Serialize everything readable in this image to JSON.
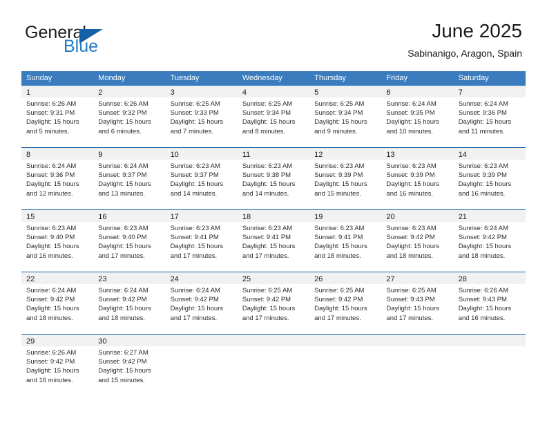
{
  "brand": {
    "name_part1": "General",
    "name_part2": "Blue",
    "mark": "triangle-logo"
  },
  "header": {
    "title": "June 2025",
    "subtitle": "Sabinanigo, Aragon, Spain"
  },
  "calendar": {
    "weekdays": [
      "Sunday",
      "Monday",
      "Tuesday",
      "Wednesday",
      "Thursday",
      "Friday",
      "Saturday"
    ],
    "accent_color": "#3a7cbe",
    "rule_color": "#1461a8",
    "daynum_band_color": "#f1f1f1",
    "weeks": [
      {
        "days": [
          {
            "num": "1",
            "sunrise": "Sunrise: 6:26 AM",
            "sunset": "Sunset: 9:31 PM",
            "daylight_line1": "Daylight: 15 hours",
            "daylight_line2": "and 5 minutes."
          },
          {
            "num": "2",
            "sunrise": "Sunrise: 6:26 AM",
            "sunset": "Sunset: 9:32 PM",
            "daylight_line1": "Daylight: 15 hours",
            "daylight_line2": "and 6 minutes."
          },
          {
            "num": "3",
            "sunrise": "Sunrise: 6:25 AM",
            "sunset": "Sunset: 9:33 PM",
            "daylight_line1": "Daylight: 15 hours",
            "daylight_line2": "and 7 minutes."
          },
          {
            "num": "4",
            "sunrise": "Sunrise: 6:25 AM",
            "sunset": "Sunset: 9:34 PM",
            "daylight_line1": "Daylight: 15 hours",
            "daylight_line2": "and 8 minutes."
          },
          {
            "num": "5",
            "sunrise": "Sunrise: 6:25 AM",
            "sunset": "Sunset: 9:34 PM",
            "daylight_line1": "Daylight: 15 hours",
            "daylight_line2": "and 9 minutes."
          },
          {
            "num": "6",
            "sunrise": "Sunrise: 6:24 AM",
            "sunset": "Sunset: 9:35 PM",
            "daylight_line1": "Daylight: 15 hours",
            "daylight_line2": "and 10 minutes."
          },
          {
            "num": "7",
            "sunrise": "Sunrise: 6:24 AM",
            "sunset": "Sunset: 9:36 PM",
            "daylight_line1": "Daylight: 15 hours",
            "daylight_line2": "and 11 minutes."
          }
        ]
      },
      {
        "days": [
          {
            "num": "8",
            "sunrise": "Sunrise: 6:24 AM",
            "sunset": "Sunset: 9:36 PM",
            "daylight_line1": "Daylight: 15 hours",
            "daylight_line2": "and 12 minutes."
          },
          {
            "num": "9",
            "sunrise": "Sunrise: 6:24 AM",
            "sunset": "Sunset: 9:37 PM",
            "daylight_line1": "Daylight: 15 hours",
            "daylight_line2": "and 13 minutes."
          },
          {
            "num": "10",
            "sunrise": "Sunrise: 6:23 AM",
            "sunset": "Sunset: 9:37 PM",
            "daylight_line1": "Daylight: 15 hours",
            "daylight_line2": "and 14 minutes."
          },
          {
            "num": "11",
            "sunrise": "Sunrise: 6:23 AM",
            "sunset": "Sunset: 9:38 PM",
            "daylight_line1": "Daylight: 15 hours",
            "daylight_line2": "and 14 minutes."
          },
          {
            "num": "12",
            "sunrise": "Sunrise: 6:23 AM",
            "sunset": "Sunset: 9:39 PM",
            "daylight_line1": "Daylight: 15 hours",
            "daylight_line2": "and 15 minutes."
          },
          {
            "num": "13",
            "sunrise": "Sunrise: 6:23 AM",
            "sunset": "Sunset: 9:39 PM",
            "daylight_line1": "Daylight: 15 hours",
            "daylight_line2": "and 16 minutes."
          },
          {
            "num": "14",
            "sunrise": "Sunrise: 6:23 AM",
            "sunset": "Sunset: 9:39 PM",
            "daylight_line1": "Daylight: 15 hours",
            "daylight_line2": "and 16 minutes."
          }
        ]
      },
      {
        "days": [
          {
            "num": "15",
            "sunrise": "Sunrise: 6:23 AM",
            "sunset": "Sunset: 9:40 PM",
            "daylight_line1": "Daylight: 15 hours",
            "daylight_line2": "and 16 minutes."
          },
          {
            "num": "16",
            "sunrise": "Sunrise: 6:23 AM",
            "sunset": "Sunset: 9:40 PM",
            "daylight_line1": "Daylight: 15 hours",
            "daylight_line2": "and 17 minutes."
          },
          {
            "num": "17",
            "sunrise": "Sunrise: 6:23 AM",
            "sunset": "Sunset: 9:41 PM",
            "daylight_line1": "Daylight: 15 hours",
            "daylight_line2": "and 17 minutes."
          },
          {
            "num": "18",
            "sunrise": "Sunrise: 6:23 AM",
            "sunset": "Sunset: 9:41 PM",
            "daylight_line1": "Daylight: 15 hours",
            "daylight_line2": "and 17 minutes."
          },
          {
            "num": "19",
            "sunrise": "Sunrise: 6:23 AM",
            "sunset": "Sunset: 9:41 PM",
            "daylight_line1": "Daylight: 15 hours",
            "daylight_line2": "and 18 minutes."
          },
          {
            "num": "20",
            "sunrise": "Sunrise: 6:23 AM",
            "sunset": "Sunset: 9:42 PM",
            "daylight_line1": "Daylight: 15 hours",
            "daylight_line2": "and 18 minutes."
          },
          {
            "num": "21",
            "sunrise": "Sunrise: 6:24 AM",
            "sunset": "Sunset: 9:42 PM",
            "daylight_line1": "Daylight: 15 hours",
            "daylight_line2": "and 18 minutes."
          }
        ]
      },
      {
        "days": [
          {
            "num": "22",
            "sunrise": "Sunrise: 6:24 AM",
            "sunset": "Sunset: 9:42 PM",
            "daylight_line1": "Daylight: 15 hours",
            "daylight_line2": "and 18 minutes."
          },
          {
            "num": "23",
            "sunrise": "Sunrise: 6:24 AM",
            "sunset": "Sunset: 9:42 PM",
            "daylight_line1": "Daylight: 15 hours",
            "daylight_line2": "and 18 minutes."
          },
          {
            "num": "24",
            "sunrise": "Sunrise: 6:24 AM",
            "sunset": "Sunset: 9:42 PM",
            "daylight_line1": "Daylight: 15 hours",
            "daylight_line2": "and 17 minutes."
          },
          {
            "num": "25",
            "sunrise": "Sunrise: 6:25 AM",
            "sunset": "Sunset: 9:42 PM",
            "daylight_line1": "Daylight: 15 hours",
            "daylight_line2": "and 17 minutes."
          },
          {
            "num": "26",
            "sunrise": "Sunrise: 6:25 AM",
            "sunset": "Sunset: 9:42 PM",
            "daylight_line1": "Daylight: 15 hours",
            "daylight_line2": "and 17 minutes."
          },
          {
            "num": "27",
            "sunrise": "Sunrise: 6:25 AM",
            "sunset": "Sunset: 9:43 PM",
            "daylight_line1": "Daylight: 15 hours",
            "daylight_line2": "and 17 minutes."
          },
          {
            "num": "28",
            "sunrise": "Sunrise: 6:26 AM",
            "sunset": "Sunset: 9:43 PM",
            "daylight_line1": "Daylight: 15 hours",
            "daylight_line2": "and 16 minutes."
          }
        ]
      },
      {
        "days": [
          {
            "num": "29",
            "sunrise": "Sunrise: 6:26 AM",
            "sunset": "Sunset: 9:42 PM",
            "daylight_line1": "Daylight: 15 hours",
            "daylight_line2": "and 16 minutes."
          },
          {
            "num": "30",
            "sunrise": "Sunrise: 6:27 AM",
            "sunset": "Sunset: 9:42 PM",
            "daylight_line1": "Daylight: 15 hours",
            "daylight_line2": "and 15 minutes."
          },
          {
            "num": "",
            "sunrise": "",
            "sunset": "",
            "daylight_line1": "",
            "daylight_line2": ""
          },
          {
            "num": "",
            "sunrise": "",
            "sunset": "",
            "daylight_line1": "",
            "daylight_line2": ""
          },
          {
            "num": "",
            "sunrise": "",
            "sunset": "",
            "daylight_line1": "",
            "daylight_line2": ""
          },
          {
            "num": "",
            "sunrise": "",
            "sunset": "",
            "daylight_line1": "",
            "daylight_line2": ""
          },
          {
            "num": "",
            "sunrise": "",
            "sunset": "",
            "daylight_line1": "",
            "daylight_line2": ""
          }
        ]
      }
    ]
  }
}
